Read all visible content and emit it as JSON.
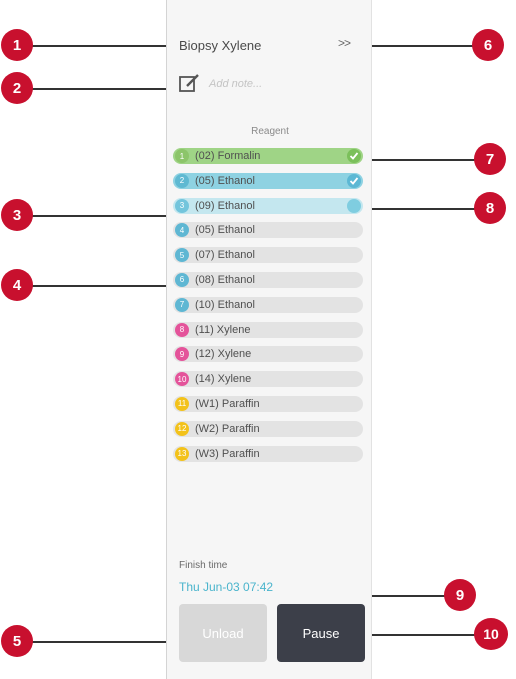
{
  "panel": {
    "title": "Biopsy Xylene",
    "expand_label": ">>",
    "note_placeholder": "Add note...",
    "reagent_header": "Reagent",
    "finish_label": "Finish time",
    "finish_time": "Thu Jun-03 07:42",
    "unload_label": "Unload",
    "pause_label": "Pause"
  },
  "reagents": [
    {
      "badge": "1",
      "label": "(02) Formalin",
      "row_color": "#9fd486",
      "badge_color": "#8cc56a",
      "status": "check",
      "status_color": "#7bc05b"
    },
    {
      "badge": "2",
      "label": "(05) Ethanol",
      "row_color": "#8ed2e2",
      "badge_color": "#5fb9d2",
      "status": "check",
      "status_color": "#5cb8d4"
    },
    {
      "badge": "3",
      "label": "(09) Ethanol",
      "row_color": "#c4e7ef",
      "badge_color": "#73c5dc",
      "status": "active",
      "status_color": "#7fcde0"
    },
    {
      "badge": "4",
      "label": "(05) Ethanol",
      "row_color": "#e3e3e3",
      "badge_color": "#5fb7d3"
    },
    {
      "badge": "5",
      "label": "(07) Ethanol",
      "row_color": "#e3e3e3",
      "badge_color": "#5fb7d3"
    },
    {
      "badge": "6",
      "label": "(08) Ethanol",
      "row_color": "#e3e3e3",
      "badge_color": "#5fb7d3"
    },
    {
      "badge": "7",
      "label": "(10) Ethanol",
      "row_color": "#e3e3e3",
      "badge_color": "#5fb7d3"
    },
    {
      "badge": "8",
      "label": "(11) Xylene",
      "row_color": "#e3e3e3",
      "badge_color": "#e4539a"
    },
    {
      "badge": "9",
      "label": "(12) Xylene",
      "row_color": "#e3e3e3",
      "badge_color": "#e4539a"
    },
    {
      "badge": "10",
      "label": "(14) Xylene",
      "row_color": "#e3e3e3",
      "badge_color": "#e4539a"
    },
    {
      "badge": "11",
      "label": "(W1) Paraffin",
      "row_color": "#e3e3e3",
      "badge_color": "#f3c21a"
    },
    {
      "badge": "12",
      "label": "(W2) Paraffin",
      "row_color": "#e3e3e3",
      "badge_color": "#f3c21a"
    },
    {
      "badge": "13",
      "label": "(W3) Paraffin",
      "row_color": "#e3e3e3",
      "badge_color": "#f3c21a"
    }
  ],
  "callouts": [
    "1",
    "2",
    "3",
    "4",
    "5",
    "6",
    "7",
    "8",
    "9",
    "10"
  ],
  "colors": {
    "callout": "#c8102e",
    "finish_time": "#4ab4cc",
    "pause_button": "#3c3f49",
    "unload_button": "#d8d8d8"
  }
}
